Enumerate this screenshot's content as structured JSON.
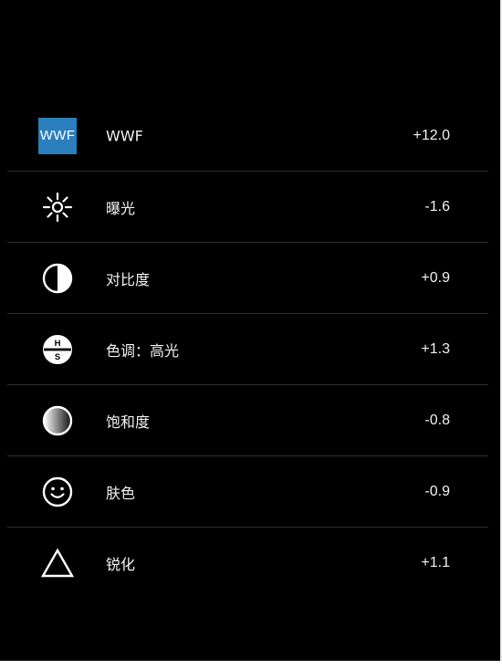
{
  "adjustments": [
    {
      "id": "wwf",
      "icon": "wwf-badge-icon",
      "icon_text": "WWF",
      "label": "WWF",
      "value": "+12.0"
    },
    {
      "id": "exposure",
      "icon": "sun-icon",
      "label": "曝光",
      "value": "-1.6"
    },
    {
      "id": "contrast",
      "icon": "contrast-icon",
      "label": "对比度",
      "value": "+0.9"
    },
    {
      "id": "tone-highlights",
      "icon": "hs-icon",
      "icon_text_top": "H",
      "icon_text_bottom": "S",
      "label": "色调：高光",
      "value": "+1.3"
    },
    {
      "id": "saturation",
      "icon": "gradient-circle-icon",
      "label": "饱和度",
      "value": "-0.8"
    },
    {
      "id": "skin-tone",
      "icon": "smiley-icon",
      "label": "肤色",
      "value": "-0.9"
    },
    {
      "id": "sharpen",
      "icon": "triangle-icon",
      "label": "锐化",
      "value": "+1.1"
    }
  ],
  "colors": {
    "background": "#000000",
    "wwf_badge": "#2a7fbc",
    "divider": "#2e2e2e",
    "text": "#f2f2f2"
  }
}
